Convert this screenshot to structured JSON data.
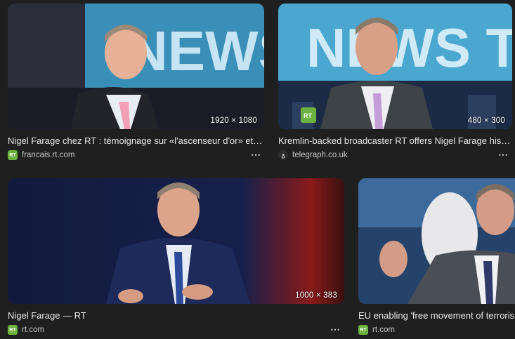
{
  "results": [
    {
      "title": "Nigel Farage chez RT : témoignage sur «l'ascenseur d'or» et…",
      "dimensions": "1920 × 1080",
      "source": "francais.rt.com",
      "favicon": "rt-icon",
      "more_label": "⋯"
    },
    {
      "title": "Kremlin-backed broadcaster RT offers Nigel Farage his …",
      "dimensions": "480 × 300",
      "source": "telegraph.co.uk",
      "favicon": "telegraph-icon",
      "more_label": "⋯"
    },
    {
      "title": "Nigel Farage — RT",
      "dimensions": "1000 × 383",
      "source": "rt.com",
      "favicon": "rt-icon",
      "more_label": "⋯"
    },
    {
      "title": "EU enabling 'free movement of terroris",
      "source": "rt.com",
      "favicon": "rt-icon"
    }
  ],
  "favicon_text": {
    "rt": "RT",
    "telegraph": "ᵹ"
  },
  "colors": {
    "background": "#1f1f1f",
    "rt_green": "#6cb33f"
  }
}
